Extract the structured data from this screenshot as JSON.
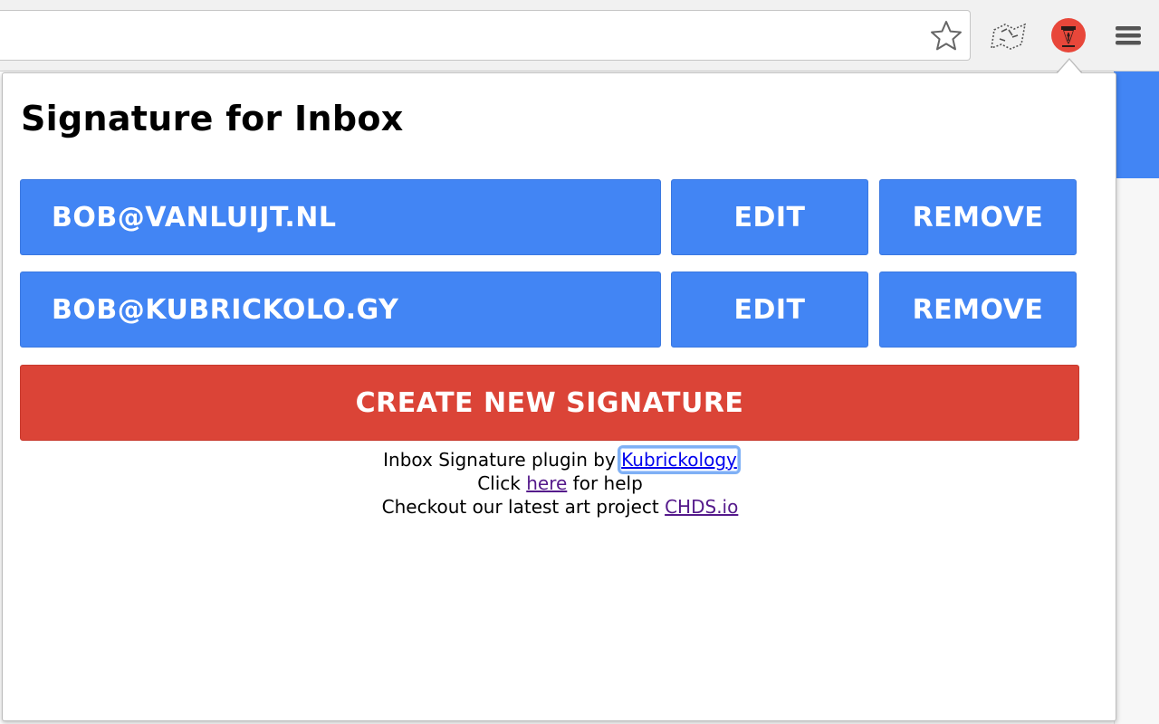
{
  "popup": {
    "title": "Signature for Inbox",
    "signatures": [
      {
        "email": "BOB@VANLUIJT.NL",
        "edit_label": "EDIT",
        "remove_label": "REMOVE"
      },
      {
        "email": "BOB@KUBRICKOLO.GY",
        "edit_label": "EDIT",
        "remove_label": "REMOVE"
      }
    ],
    "create_label": "CREATE NEW SIGNATURE",
    "footer": {
      "line1_text": "Inbox Signature plugin by ",
      "line1_link": "Kubrickology",
      "line2_prefix": "Click ",
      "line2_link": "here",
      "line2_suffix": " for help",
      "line3_text": "Checkout our latest art project ",
      "line3_link": "CHDS.io"
    }
  },
  "toolbar": {
    "icons": [
      "star-icon",
      "map-extension-icon",
      "pen-extension-icon",
      "hamburger-menu-icon"
    ]
  },
  "colors": {
    "primary_blue": "#4285f4",
    "danger_red": "#db4437",
    "link_blue": "#0000ee",
    "link_visited": "#551a8b"
  }
}
